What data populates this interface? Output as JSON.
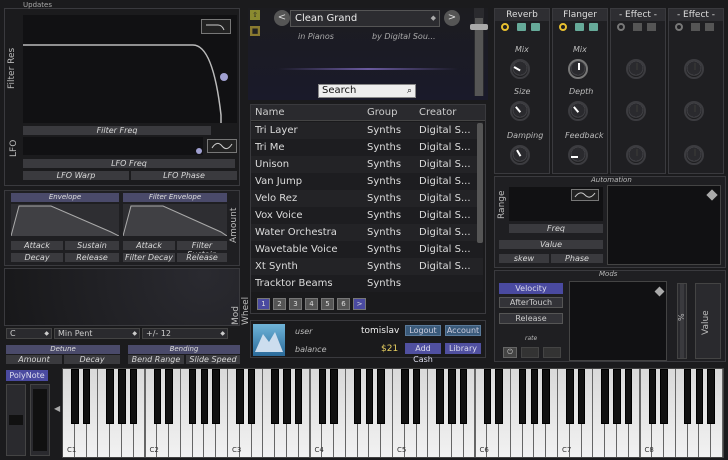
{
  "top_bar": {
    "updates_label": "Updates"
  },
  "filter": {
    "res_label": "Filter Res",
    "freq_label": "Filter Freq"
  },
  "lfo": {
    "label": "LFO",
    "freq_label": "LFO Freq",
    "warp_label": "LFO Warp",
    "phase_label": "LFO Phase"
  },
  "envelope": {
    "title": "Envelope",
    "attack": "Attack",
    "sustain": "Sustain",
    "decay": "Decay",
    "release": "Release"
  },
  "filter_envelope": {
    "title": "Filter Envelope",
    "attack": "Attack",
    "sustain": "Filter Sustain",
    "decay": "Filter Decay",
    "release": "Release",
    "amount": "Amount"
  },
  "mod_wheel": {
    "label": "Mod Wheel"
  },
  "scale": {
    "root": "C",
    "scale": "Min Pent",
    "range": "+/- 12"
  },
  "detune": {
    "title": "Detune",
    "amount": "Amount",
    "decay": "Decay"
  },
  "bending": {
    "title": "Bending",
    "bend_range": "Bend Range",
    "slide_speed": "Slide Speed"
  },
  "preset": {
    "name": "Clean Grand",
    "category": "in Pianos",
    "author": "by Digital Sou...",
    "search_label": "Search"
  },
  "browser": {
    "columns": [
      "Name",
      "Group",
      "Creator"
    ],
    "rows": [
      [
        "Tri Layer",
        "Synths",
        "Digital S..."
      ],
      [
        "Tri Me",
        "Synths",
        "Digital S..."
      ],
      [
        "Unison",
        "Synths",
        "Digital S..."
      ],
      [
        "Van Jump",
        "Synths",
        "Digital S..."
      ],
      [
        "Velo Rez",
        "Synths",
        "Digital S..."
      ],
      [
        "Vox Voice",
        "Synths",
        "Digital S..."
      ],
      [
        "Water Orchestra",
        "Synths",
        "Digital S..."
      ],
      [
        "Wavetable Voice",
        "Synths",
        "Digital S..."
      ],
      [
        "Xt Synth",
        "Synths",
        "Digital S..."
      ],
      [
        "Tracktor Beams",
        "Synths",
        ""
      ]
    ],
    "pages": [
      "1",
      "2",
      "3",
      "4",
      "5",
      "6",
      ">"
    ]
  },
  "account": {
    "user_label": "user",
    "user_value": "tomislav",
    "balance_label": "balance",
    "balance_value": "$21",
    "logout": "Logout",
    "account": "Account",
    "add_cash": "Add Cash",
    "library": "Library"
  },
  "effects": {
    "reverb": {
      "title": "Reverb",
      "mix": "Mix",
      "size": "Size",
      "damping": "Damping"
    },
    "flanger": {
      "title": "Flanger",
      "mix": "Mix",
      "depth": "Depth",
      "feedback": "Feedback"
    },
    "slot3": {
      "title": "- Effect -"
    },
    "slot4": {
      "title": "- Effect -"
    }
  },
  "automation": {
    "title": "Automation",
    "range": "Range",
    "freq": "Freq",
    "value": "Value",
    "skew": "skew",
    "phase": "Phase"
  },
  "mods": {
    "title": "Mods",
    "velocity": "Velocity",
    "aftertouch": "AfterTouch",
    "release": "Release",
    "rate": "rate",
    "percent": "%",
    "value": "Value"
  },
  "keyboard": {
    "polynote": "PolyNote",
    "octaves": [
      "C1",
      "C2",
      "C3",
      "C4",
      "C5",
      "C6",
      "C7",
      "C8"
    ]
  },
  "colors": {
    "accent_purple": "#5050a0",
    "accent_blue": "#3a5a7a"
  }
}
